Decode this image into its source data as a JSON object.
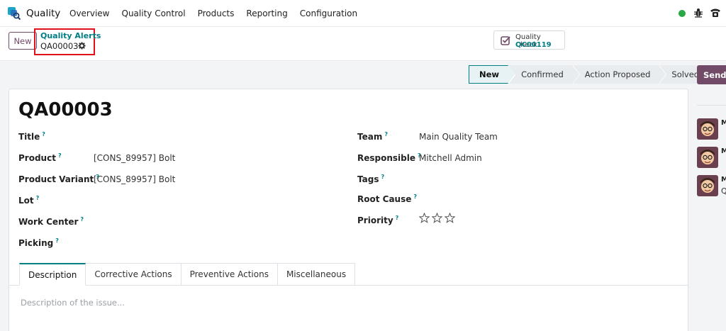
{
  "app": {
    "name": "Quality"
  },
  "menu": [
    "Overview",
    "Quality Control",
    "Products",
    "Reporting",
    "Configuration"
  ],
  "control": {
    "new_label": "New",
    "breadcrumb_parent": "Quality Alerts",
    "breadcrumb_current": "QA00003",
    "smart_button_label": "Quality Check",
    "smart_button_value": "QC00119"
  },
  "stages": [
    "New",
    "Confirmed",
    "Action Proposed",
    "Solved"
  ],
  "active_stage": "New",
  "send_label": "Send m",
  "form": {
    "title": "QA00003",
    "left_fields": [
      {
        "label": "Title",
        "value": ""
      },
      {
        "label": "Product",
        "value": "[CONS_89957] Bolt"
      },
      {
        "label": "Product Variant",
        "value": "[CONS_89957] Bolt"
      },
      {
        "label": "Lot",
        "value": ""
      },
      {
        "label": "Work Center",
        "value": ""
      },
      {
        "label": "Picking",
        "value": ""
      }
    ],
    "right_fields": [
      {
        "label": "Team",
        "value": "Main Quality Team"
      },
      {
        "label": "Responsible",
        "value": "Mitchell Admin"
      },
      {
        "label": "Tags",
        "value": ""
      },
      {
        "label": "Root Cause",
        "value": ""
      },
      {
        "label": "Priority",
        "value": ""
      }
    ],
    "help_mark": "?",
    "priority_stars": 3,
    "priority_value": 0
  },
  "tabs": [
    "Description",
    "Corrective Actions",
    "Preventive Actions",
    "Miscellaneous"
  ],
  "description_placeholder": "Description of the issue...",
  "chatter": [
    {
      "author": "M",
      "text": ""
    },
    {
      "author": "M",
      "text": ""
    },
    {
      "author": "M",
      "text": "Q"
    }
  ],
  "colors": {
    "brand": "#714b67",
    "accent": "#017e84",
    "highlight_border": "#e0111a",
    "online": "#28a745"
  }
}
